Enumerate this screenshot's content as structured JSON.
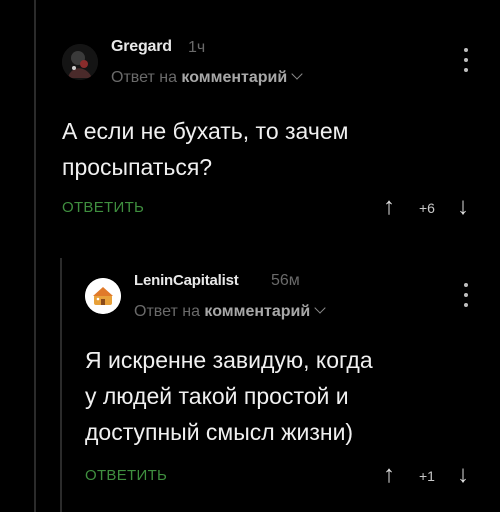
{
  "comments": [
    {
      "author": "Gregard",
      "time": "1ч",
      "reply_prefix": "Ответ на",
      "reply_target": "комментарий",
      "lines": [
        "А если не бухать, то зачем",
        "просыпаться?"
      ],
      "reply_label": "ОТВЕТИТЬ",
      "rating": "+6"
    },
    {
      "author": "LeninCapitalist",
      "time": "56м",
      "reply_prefix": "Ответ на",
      "reply_target": "комментарий",
      "lines": [
        "Я искренне завидую, когда",
        "у людей такой простой и",
        "доступный смысл жизни)"
      ],
      "reply_label": "ОТВЕТИТЬ",
      "rating": "+1"
    }
  ],
  "icons": {
    "upvote": "arrow-up-icon",
    "downvote": "arrow-down-icon",
    "more": "kebab-menu-icon",
    "expand": "chevron-down-icon"
  },
  "colors": {
    "background": "#000000",
    "reply_button": "#3f8f3f",
    "muted_text": "#6a6a6a",
    "thread_line": "#2b2b2b"
  }
}
